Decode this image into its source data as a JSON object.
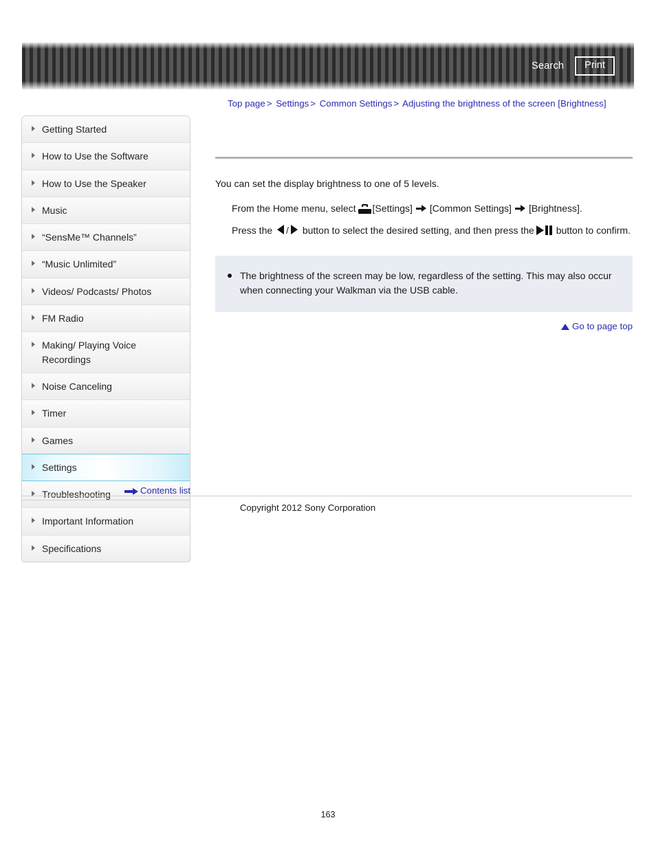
{
  "header": {
    "search_label": "Search",
    "print_label": "Print"
  },
  "breadcrumb": {
    "items": [
      {
        "label": "Top page"
      },
      {
        "label": "Settings"
      },
      {
        "label": "Common Settings"
      },
      {
        "label": "Adjusting the brightness of the screen [Brightness]"
      }
    ],
    "separator": ">"
  },
  "sidebar": {
    "items": [
      {
        "label": "Getting Started",
        "active": false
      },
      {
        "label": "How to Use the Software",
        "active": false
      },
      {
        "label": "How to Use the Speaker",
        "active": false
      },
      {
        "label": "Music",
        "active": false
      },
      {
        "label": "“SensMe™ Channels”",
        "active": false
      },
      {
        "label": "“Music Unlimited”",
        "active": false
      },
      {
        "label": "Videos/ Podcasts/ Photos",
        "active": false
      },
      {
        "label": "FM Radio",
        "active": false
      },
      {
        "label": "Making/ Playing Voice Recordings",
        "active": false
      },
      {
        "label": "Noise Canceling",
        "active": false
      },
      {
        "label": "Timer",
        "active": false
      },
      {
        "label": "Games",
        "active": false
      },
      {
        "label": "Settings",
        "active": true
      },
      {
        "label": "Troubleshooting",
        "active": false
      },
      {
        "label": "Important Information",
        "active": false
      },
      {
        "label": "Specifications",
        "active": false
      }
    ],
    "contents_list_label": "Contents list"
  },
  "main": {
    "intro": "You can set the display brightness to one of 5 levels.",
    "step1": {
      "before_icon": "From the Home menu, select",
      "settings_bracket": "[Settings]",
      "common_settings_bracket": "[Common Settings]",
      "brightness_bracket": "[Brightness]."
    },
    "step2": {
      "press_the": "Press the",
      "slash": "/",
      "middle": "button to select the desired setting, and then press the",
      "tail": "button to confirm."
    },
    "note": "The brightness of the screen may be low, regardless of the setting. This may also occur when connecting your Walkman via the USB cable.",
    "go_to_top_label": "Go to page top"
  },
  "footer": {
    "copyright": "Copyright 2012 Sony Corporation",
    "page_number": "163"
  },
  "colors": {
    "link": "#2b2bb0",
    "active_border": "#6dc8e4",
    "note_bg": "#e9edf3",
    "rule": "#b3b3b3"
  }
}
